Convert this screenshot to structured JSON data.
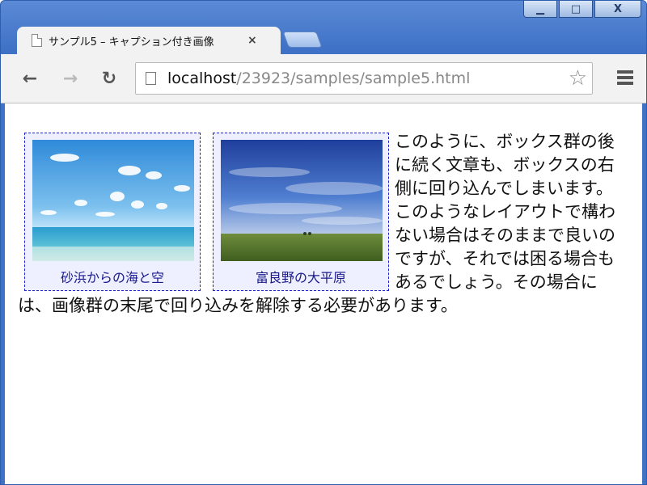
{
  "window": {
    "minimize_label": "▁",
    "maximize_label": "□",
    "close_label": "X"
  },
  "tab": {
    "title": "サンプル5 – キャプション付き画像",
    "close_label": "×"
  },
  "toolbar": {
    "back_icon": "←",
    "forward_icon": "→",
    "reload_icon": "↻",
    "url_host": "localhost",
    "url_rest": "/23923/samples/sample5.html",
    "star_icon": "☆"
  },
  "figures": [
    {
      "caption": "砂浜からの海と空",
      "image": "beach-sea-sky"
    },
    {
      "caption": "富良野の大平原",
      "image": "furano-plain"
    }
  ],
  "article": {
    "text": "このように、ボックス群の後に続く文章も、ボックスの右側に回り込んでしまいます。このようなレイアウトで構わない場合はそのままで良いのですが、それでは困る場合もあるでしょう。その場合には、画像群の末尾で回り込みを解除する必要があります。"
  }
}
